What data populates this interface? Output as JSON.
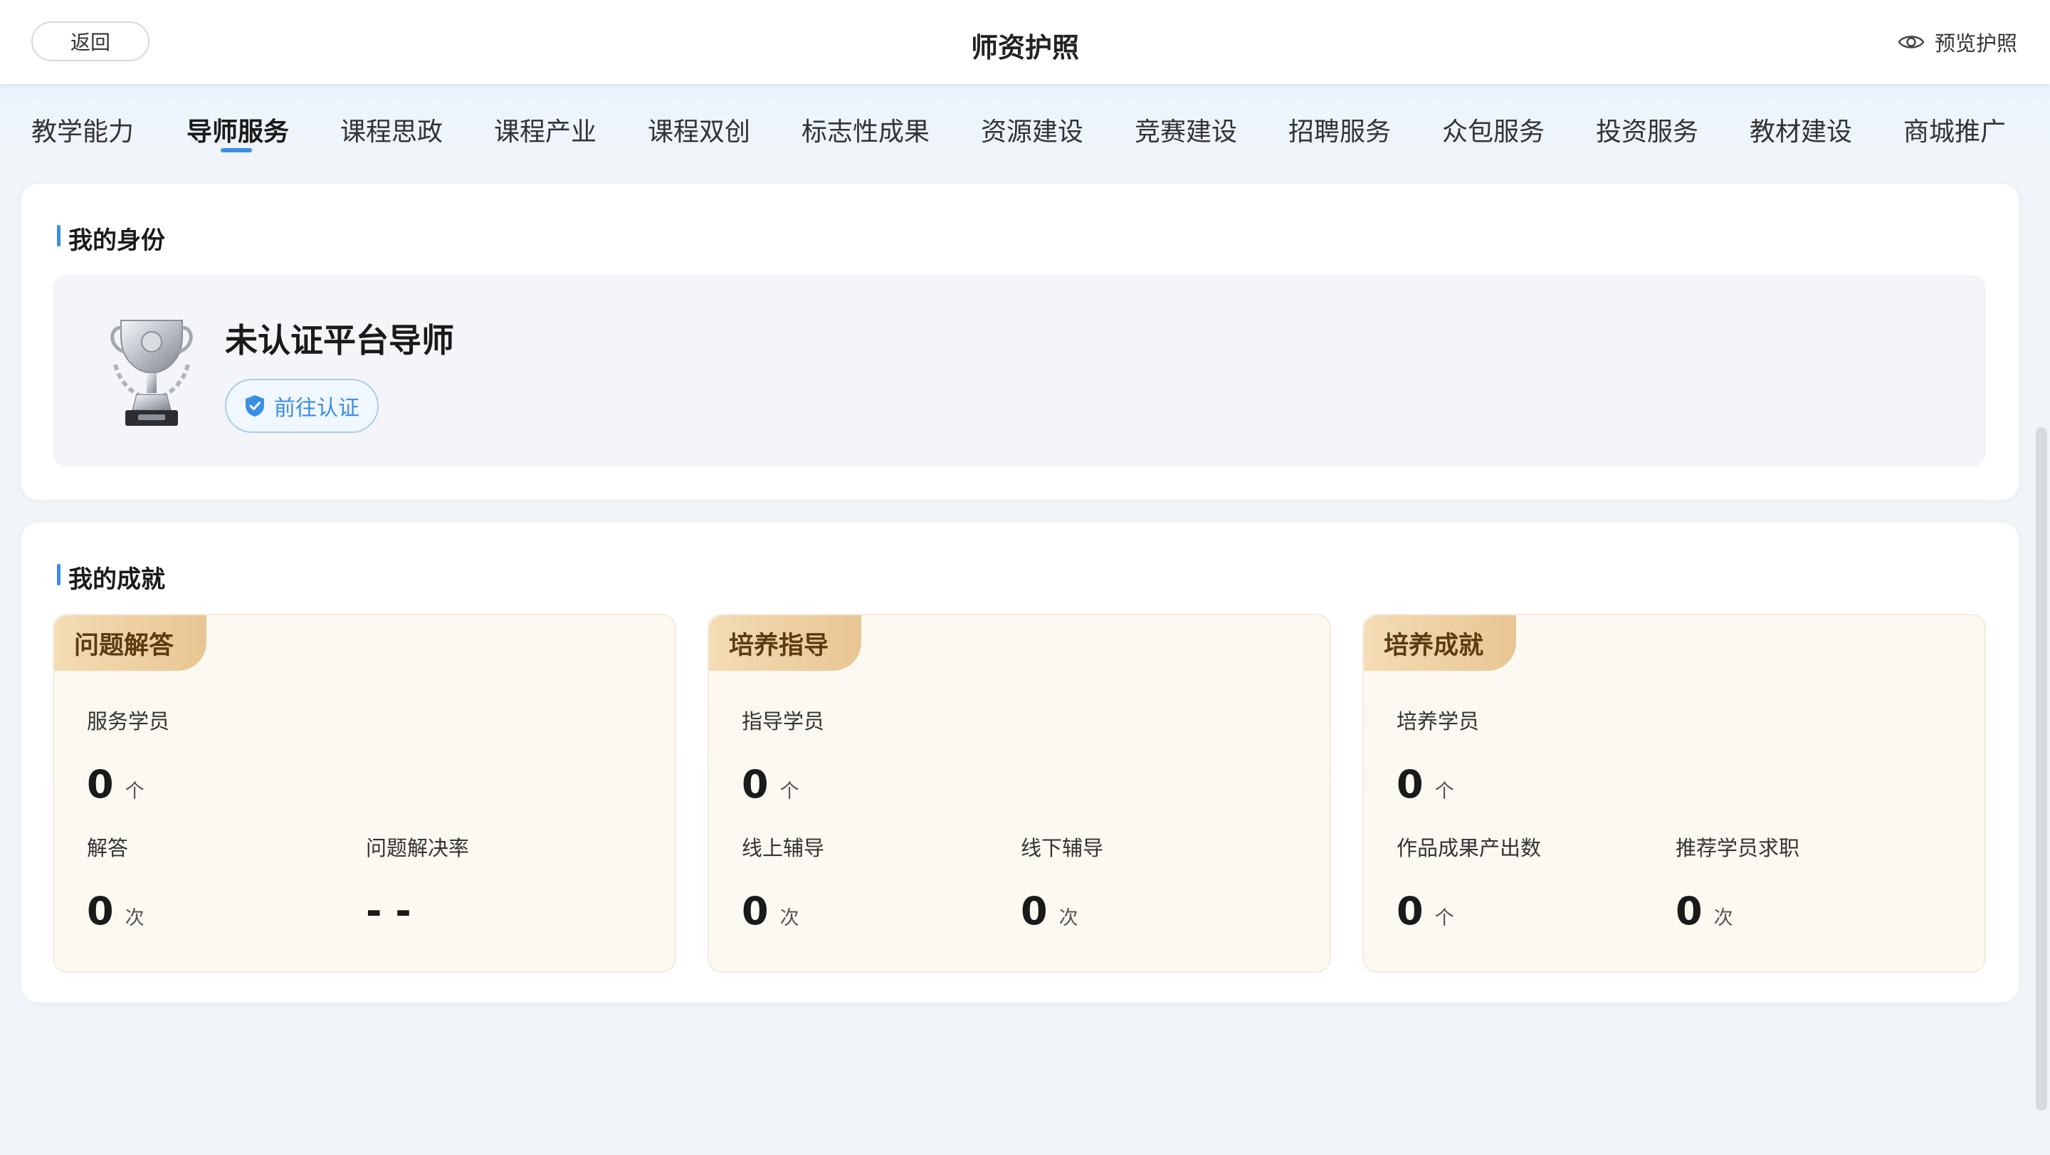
{
  "header": {
    "back_label": "返回",
    "title": "师资护照",
    "preview_label": "预览护照"
  },
  "tabs": [
    {
      "label": "教学能力",
      "active": false
    },
    {
      "label": "导师服务",
      "active": true
    },
    {
      "label": "课程思政",
      "active": false
    },
    {
      "label": "课程产业",
      "active": false
    },
    {
      "label": "课程双创",
      "active": false
    },
    {
      "label": "标志性成果",
      "active": false
    },
    {
      "label": "资源建设",
      "active": false
    },
    {
      "label": "竞赛建设",
      "active": false
    },
    {
      "label": "招聘服务",
      "active": false
    },
    {
      "label": "众包服务",
      "active": false
    },
    {
      "label": "投资服务",
      "active": false
    },
    {
      "label": "教材建设",
      "active": false
    },
    {
      "label": "商城推广",
      "active": false
    }
  ],
  "identity": {
    "section_title": "我的身份",
    "status_text": "未认证平台导师",
    "certify_label": "前往认证"
  },
  "achievements": {
    "section_title": "我的成就",
    "blocks": [
      {
        "badge": "问题解答",
        "main": {
          "label": "服务学员",
          "value": "0",
          "unit": "个"
        },
        "left": {
          "label": "解答",
          "value": "0",
          "unit": "次"
        },
        "right": {
          "label": "问题解决率",
          "value": "- -",
          "unit": ""
        }
      },
      {
        "badge": "培养指导",
        "main": {
          "label": "指导学员",
          "value": "0",
          "unit": "个"
        },
        "left": {
          "label": "线上辅导",
          "value": "0",
          "unit": "次"
        },
        "right": {
          "label": "线下辅导",
          "value": "0",
          "unit": "次"
        }
      },
      {
        "badge": "培养成就",
        "main": {
          "label": "培养学员",
          "value": "0",
          "unit": "个"
        },
        "left": {
          "label": "作品成果产出数",
          "value": "0",
          "unit": "个"
        },
        "right": {
          "label": "推荐学员求职",
          "value": "0",
          "unit": "次"
        }
      }
    ]
  },
  "colors": {
    "accent": "#3a8ee6",
    "badge_gold": "#e8c693",
    "badge_text": "#5a3b12"
  }
}
